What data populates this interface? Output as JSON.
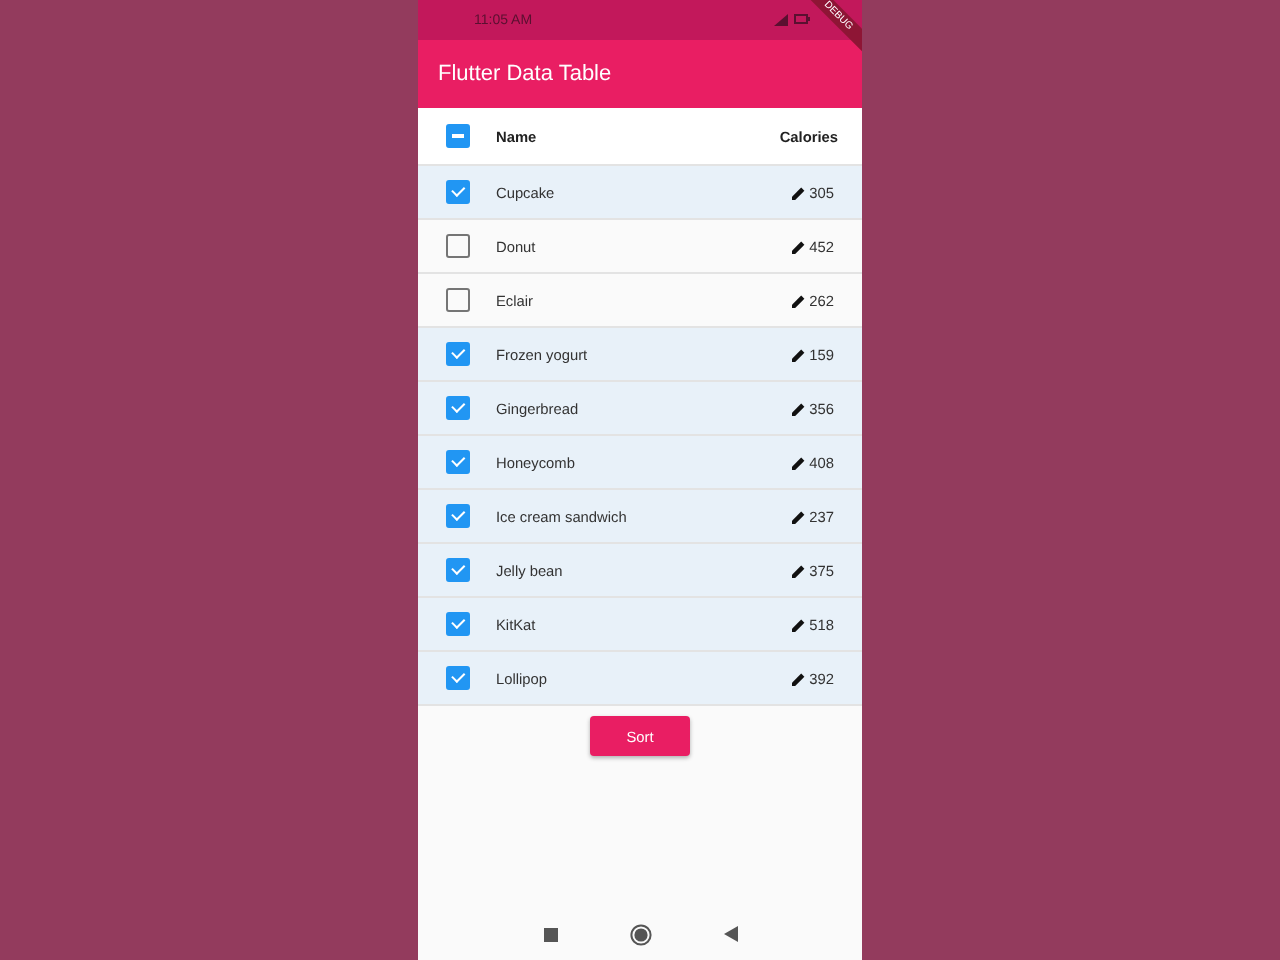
{
  "status_bar": {
    "time": "11:05 AM"
  },
  "debug_banner": "DEBUG",
  "app_bar": {
    "title": "Flutter Data Table"
  },
  "table": {
    "header_indeterminate": true,
    "columns": [
      "Name",
      "Calories"
    ],
    "rows": [
      {
        "name": "Cupcake",
        "calories": "305",
        "selected": true
      },
      {
        "name": "Donut",
        "calories": "452",
        "selected": false
      },
      {
        "name": "Eclair",
        "calories": "262",
        "selected": false
      },
      {
        "name": "Frozen yogurt",
        "calories": "159",
        "selected": true
      },
      {
        "name": "Gingerbread",
        "calories": "356",
        "selected": true
      },
      {
        "name": "Honeycomb",
        "calories": "408",
        "selected": true
      },
      {
        "name": "Ice cream sandwich",
        "calories": "237",
        "selected": true
      },
      {
        "name": "Jelly bean",
        "calories": "375",
        "selected": true
      },
      {
        "name": "KitKat",
        "calories": "518",
        "selected": true
      },
      {
        "name": "Lollipop",
        "calories": "392",
        "selected": true
      }
    ]
  },
  "button": "Sort"
}
